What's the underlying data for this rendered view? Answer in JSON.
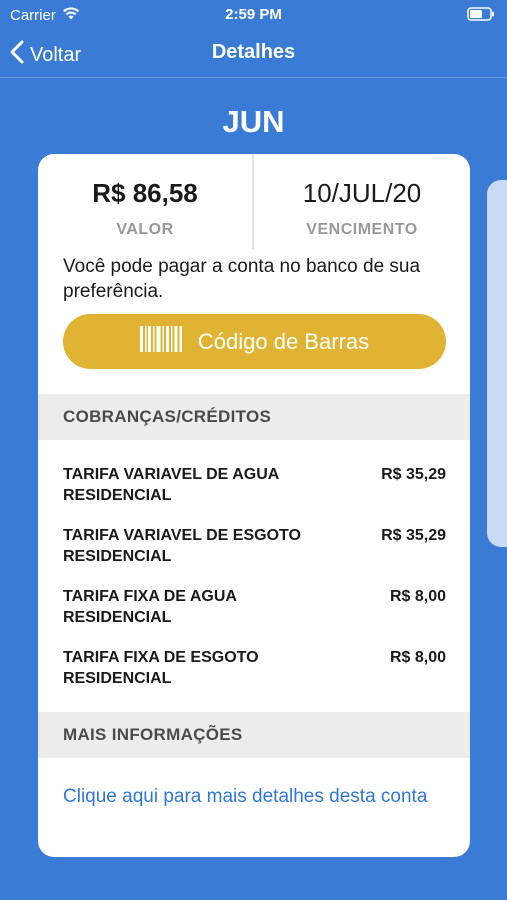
{
  "status_bar": {
    "carrier": "Carrier",
    "time": "2:59 PM"
  },
  "nav": {
    "back_label": "Voltar",
    "title": "Detalhes"
  },
  "month": "JUN",
  "summary": {
    "amount_value": "R$ 86,58",
    "amount_label": "VALOR",
    "due_value": "10/JUL/20",
    "due_label": "VENCIMENTO"
  },
  "info_text": "Você pode pagar a conta no banco de sua preferência.",
  "barcode_button_label": "Código de Barras",
  "charges_section": {
    "title": "COBRANÇAS/CRÉDITOS",
    "items": [
      {
        "name": "TARIFA VARIAVEL DE AGUA RESIDENCIAL",
        "amount": "R$ 35,29"
      },
      {
        "name": "TARIFA VARIAVEL DE ESGOTO RESIDENCIAL",
        "amount": "R$ 35,29"
      },
      {
        "name": "TARIFA FIXA DE AGUA RESIDENCIAL",
        "amount": "R$ 8,00"
      },
      {
        "name": "TARIFA FIXA DE ESGOTO RESIDENCIAL",
        "amount": "R$ 8,00"
      }
    ]
  },
  "more_info": {
    "title": "MAIS INFORMAÇÕES",
    "link_text": "Clique aqui para mais detalhes desta conta"
  },
  "colors": {
    "background": "#3a7bd5",
    "button": "#e0b432",
    "link": "#2f78d8"
  },
  "icons": [
    "wifi-icon",
    "battery-icon",
    "chevron-left-icon",
    "barcode-icon"
  ]
}
